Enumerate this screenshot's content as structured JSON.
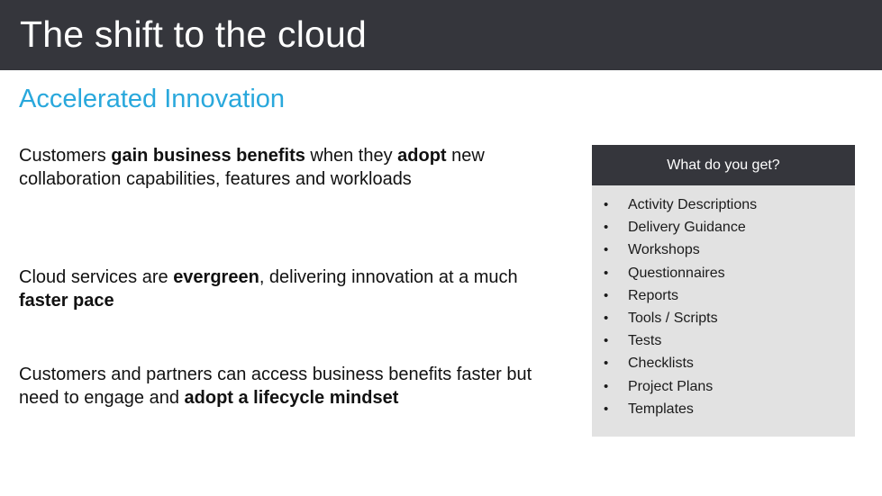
{
  "slide": {
    "title": "The shift to the cloud",
    "section_heading": "Accelerated Innovation",
    "colors": {
      "header_bar": "#35363C",
      "accent": "#29A8DC",
      "panel_body": "#E2E2E2",
      "panel_header": "#35363C",
      "body_text": "#111111",
      "page_background": "#FFFFFF"
    }
  },
  "body": {
    "paragraphs": [
      {
        "id": "para-1",
        "runs": [
          {
            "text": "Customers ",
            "bold": false
          },
          {
            "text": "gain business benefits",
            "bold": true
          },
          {
            "text": " when they ",
            "bold": false
          },
          {
            "text": "adopt",
            "bold": true
          },
          {
            "text": " new collaboration capabilities, features and workloads",
            "bold": false
          }
        ]
      },
      {
        "id": "para-2",
        "runs": [
          {
            "text": "Cloud services are ",
            "bold": false
          },
          {
            "text": "evergreen",
            "bold": true
          },
          {
            "text": ", delivering innovation at a much ",
            "bold": false
          },
          {
            "text": "faster pace",
            "bold": true
          }
        ]
      },
      {
        "id": "para-3",
        "runs": [
          {
            "text": "Customers and partners can access business benefits faster but need to engage and ",
            "bold": false
          },
          {
            "text": "adopt a lifecycle mindset",
            "bold": true
          }
        ]
      }
    ]
  },
  "panel": {
    "header": "What do you get?",
    "items": [
      "Activity Descriptions",
      "Delivery Guidance",
      "Workshops",
      "Questionnaires",
      "Reports",
      "Tools / Scripts",
      "Tests",
      "Checklists",
      "Project Plans",
      "Templates"
    ]
  }
}
